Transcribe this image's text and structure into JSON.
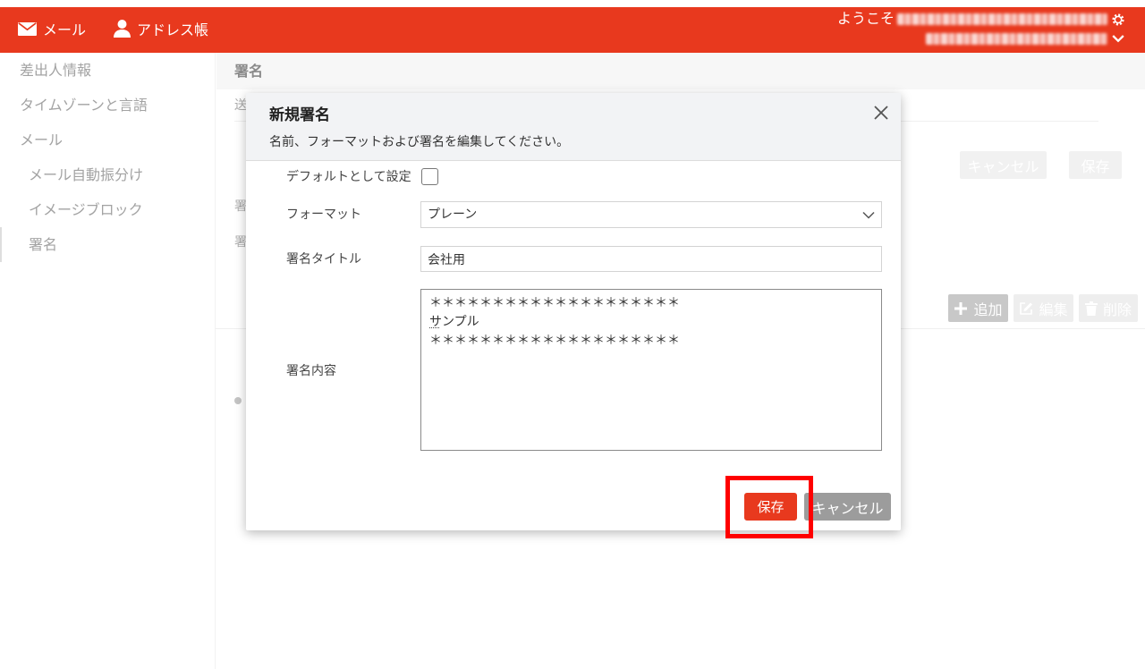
{
  "theme": {
    "accent_color": "#e8391e",
    "secondary_button_color": "#9c9c9c",
    "annotation_color": "#ff0000"
  },
  "header": {
    "nav": [
      {
        "label": "メール",
        "icon": "mail-icon"
      },
      {
        "label": "アドレス帳",
        "icon": "person-icon"
      }
    ],
    "welcome_label": "ようこそ",
    "settings_icon": "gear-icon",
    "account_menu_icon": "chevron-down-icon"
  },
  "sidebar": {
    "items": [
      {
        "label": "差出人情報"
      },
      {
        "label": "タイムゾーンと言語"
      },
      {
        "label": "メール"
      },
      {
        "label": "メール自動振分け"
      },
      {
        "label": "イメージブロック"
      },
      {
        "label": "署名",
        "selected": true
      }
    ]
  },
  "main": {
    "title": "署名",
    "partial_labels": [
      "送",
      "署",
      "署"
    ],
    "form_buttons": {
      "cancel_label": "キャンセル",
      "save_label": "保存"
    },
    "list_toolbar": {
      "add_label": "追加",
      "add_icon": "plus-icon",
      "edit_label": "編集",
      "edit_icon": "edit-icon",
      "delete_label": "削除",
      "delete_icon": "trash-icon"
    }
  },
  "modal": {
    "title": "新規署名",
    "subtitle": "名前、フォーマットおよび署名を編集してください。",
    "close_icon": "close-icon",
    "default_field": {
      "label": "デフォルトとして設定",
      "checked": false
    },
    "format_field": {
      "label": "フォーマット",
      "value": "プレーン",
      "icon": "chevron-down-icon"
    },
    "title_field": {
      "label": "署名タイトル",
      "value": "会社用"
    },
    "content_field": {
      "label": "署名内容",
      "lines": [
        "＊＊＊＊＊＊＊＊＊＊＊＊＊＊＊＊＊＊＊＊",
        "サンプル",
        "＊＊＊＊＊＊＊＊＊＊＊＊＊＊＊＊＊＊＊＊"
      ]
    },
    "buttons": {
      "save_label": "保存",
      "cancel_label": "キャンセル"
    }
  }
}
